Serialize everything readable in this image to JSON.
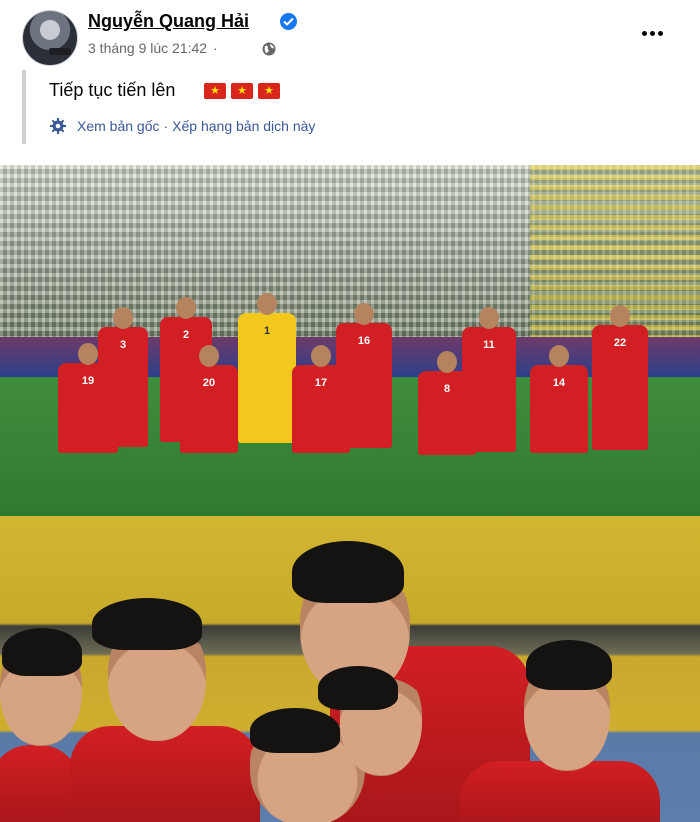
{
  "post": {
    "author_name": "Nguyễn Quang Hải",
    "timestamp": "3 tháng 9 lúc 21:42",
    "meta_separator": "·",
    "text": "Tiếp tục tiến lên",
    "flag_count": 3,
    "translate": {
      "see_original": "Xem bản gốc",
      "separator": "·",
      "rate_translation": "Xếp hạng bản dịch này"
    }
  },
  "icons": {
    "verified": "verified-badge-icon",
    "audience": "globe-icon",
    "more": "more-options-icon",
    "translate": "gear-icon",
    "flag": "vietnam-flag-emoji"
  },
  "photo1": {
    "jersey_numbers": [
      "3",
      "2",
      "1",
      "16",
      "11",
      "22",
      "19",
      "20",
      "17",
      "8",
      "14"
    ]
  },
  "colors": {
    "link": "#385898",
    "verified": "#1877f2",
    "jersey_red": "#d21f23",
    "goalkeeper_yellow": "#f2c81d"
  }
}
